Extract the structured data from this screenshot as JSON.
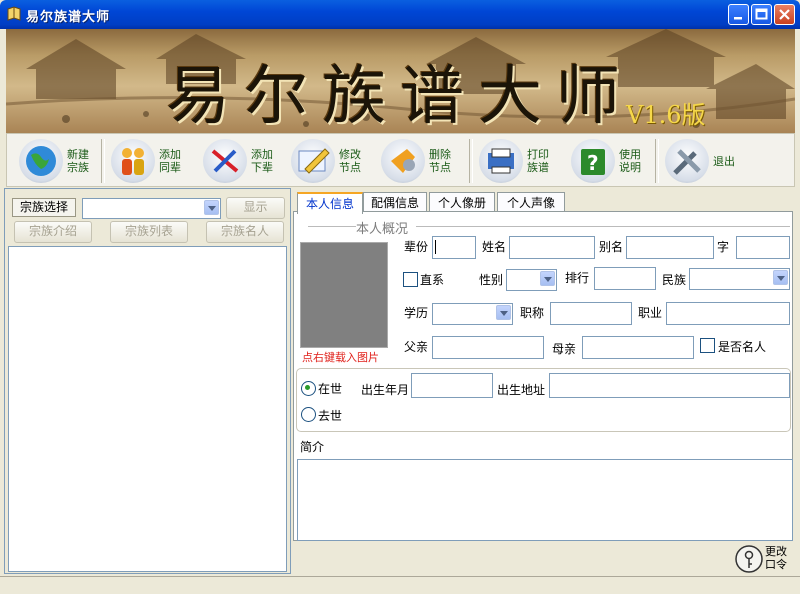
{
  "window": {
    "title": "易尔族谱大师"
  },
  "banner": {
    "title": "易尔族谱大师",
    "version": "V1.6版"
  },
  "toolbar": {
    "items": [
      {
        "label": "新建\n宗族",
        "icon": "globe-icon"
      },
      {
        "label": "添加\n同辈",
        "icon": "people-icon"
      },
      {
        "label": "添加\n下辈",
        "icon": "tools-icon"
      },
      {
        "label": "修改\n节点",
        "icon": "edit-icon"
      },
      {
        "label": "删除\n节点",
        "icon": "delete-icon"
      },
      {
        "label": "打印\n族谱",
        "icon": "print-icon"
      },
      {
        "label": "使用\n说明",
        "icon": "help-icon"
      },
      {
        "label": "退出",
        "icon": "exit-icon"
      }
    ]
  },
  "left": {
    "clan_select_label": "宗族选择",
    "clan_select_value": "",
    "show_button": "显示",
    "clan_intro_button": "宗族介绍",
    "clan_list_button": "宗族列表",
    "clan_celebrity_button": "宗族名人"
  },
  "tabs": [
    {
      "label": "本人信息",
      "active": true
    },
    {
      "label": "配偶信息",
      "active": false
    },
    {
      "label": "个人像册",
      "active": false
    },
    {
      "label": "个人声像",
      "active": false
    }
  ],
  "profile": {
    "section_title": "本人概况",
    "photo_hint": "点右键载入图片",
    "generation_label": "辈份",
    "generation_value": "",
    "name_label": "姓名",
    "name_value": "",
    "alias_label": "别名",
    "alias_value": "",
    "courtesy_label": "字",
    "courtesy_value": "",
    "direct_label": "直系",
    "direct_checked": false,
    "gender_label": "性别",
    "gender_value": "",
    "rank_label": "排行",
    "rank_value": "",
    "ethnicity_label": "民族",
    "ethnicity_value": "",
    "education_label": "学历",
    "education_value": "",
    "title_label": "职称",
    "title_value": "",
    "occupation_label": "职业",
    "occupation_value": "",
    "father_label": "父亲",
    "father_value": "",
    "mother_label": "母亲",
    "mother_value": "",
    "famous_label": "是否名人",
    "famous_checked": false,
    "alive_label": "在世",
    "alive_selected": true,
    "deceased_label": "去世",
    "deceased_selected": false,
    "birth_date_label": "出生年月",
    "birth_date_value": "",
    "birth_place_label": "出生地址",
    "birth_place_value": "",
    "bio_label": "简介",
    "bio_value": ""
  },
  "password_button": "更改\n口令",
  "colors": {
    "titlebar": "#0046d5",
    "active_tab_accent": "#f5a623",
    "photo_hint": "#e0201a",
    "toolbar_label": "#1a5a16"
  }
}
